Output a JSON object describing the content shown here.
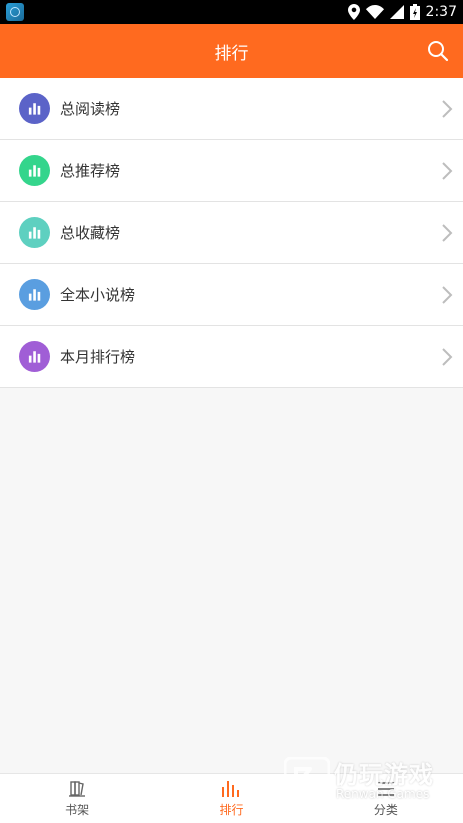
{
  "status_bar": {
    "time": "2:37"
  },
  "header": {
    "title": "排行",
    "search_icon": "search-icon"
  },
  "rankings": [
    {
      "label": "总阅读榜",
      "color": "#5b63c8"
    },
    {
      "label": "总推荐榜",
      "color": "#34d58c"
    },
    {
      "label": "总收藏榜",
      "color": "#5ed0c0"
    },
    {
      "label": "全本小说榜",
      "color": "#5a9ee0"
    },
    {
      "label": "本月排行榜",
      "color": "#a05ed6"
    }
  ],
  "tabs": [
    {
      "label": "书架",
      "icon": "bookshelf-icon",
      "active": false
    },
    {
      "label": "排行",
      "icon": "ranking-icon",
      "active": true
    },
    {
      "label": "分类",
      "icon": "category-icon",
      "active": false
    }
  ],
  "colors": {
    "accent": "#ff6a1f"
  },
  "watermark": {
    "cn": "仍玩游戏",
    "en": "Renwan Games"
  }
}
